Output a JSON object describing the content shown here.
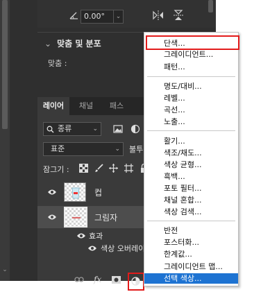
{
  "transform": {
    "angle_value": "0.00°"
  },
  "align_section": {
    "title": "맞춤 및 분포",
    "align_label": "맞춤 :"
  },
  "tabs": [
    {
      "label": "레이어",
      "active": true
    },
    {
      "label": "채널",
      "active": false
    },
    {
      "label": "패스",
      "active": false
    }
  ],
  "layers_panel": {
    "kind_filter": "종류",
    "blend_mode": "표준",
    "opacity_label": "불투",
    "lock_label": "잠그기 :",
    "layers": [
      {
        "name": "컵"
      },
      {
        "name": "그림자"
      }
    ],
    "effects_label": "효과",
    "effect_item": "색상 오버레이"
  },
  "footer_buttons": {
    "link_icon": "link-icon",
    "fx_label": "fx",
    "mask_icon": "mask-icon",
    "adjustment_icon": "adjustment-layer-icon"
  },
  "adjustment_menu": {
    "groups": [
      [
        "단색...",
        "그레이디언트...",
        "패턴..."
      ],
      [
        "명도/대비...",
        "레벨...",
        "곡선...",
        "노출..."
      ],
      [
        "활기...",
        "색조/채도...",
        "색상 균형...",
        "흑백...",
        "포토 필터...",
        "채널 혼합...",
        "색상 검색..."
      ],
      [
        "반전",
        "포스터화...",
        "한계값...",
        "그레이디언트 맵...",
        "선택 색상..."
      ]
    ],
    "highlighted": "선택 색상...",
    "boxed": "단색..."
  },
  "colors": {
    "panel_bg": "#3a3a3a",
    "highlight": "#1e73d2",
    "annotation_box": "#e21b1b"
  }
}
